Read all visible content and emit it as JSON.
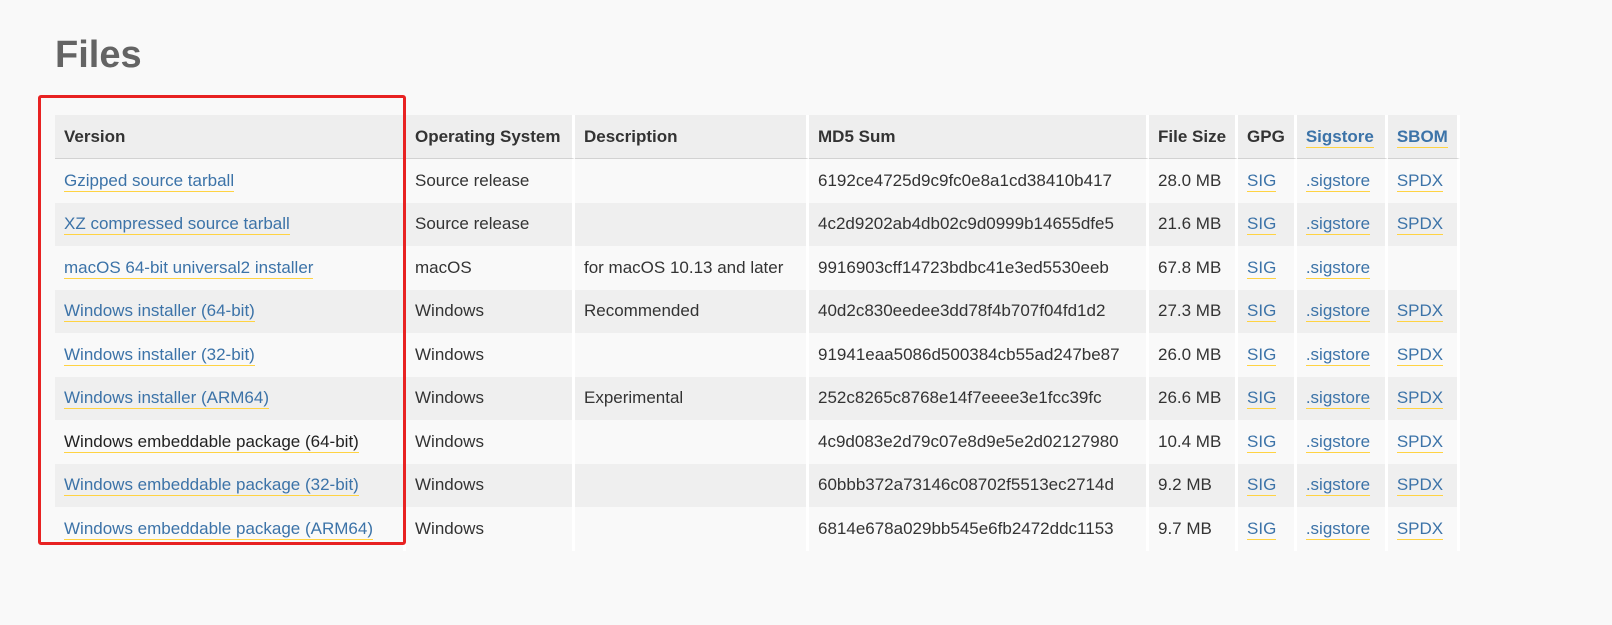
{
  "page": {
    "title": "Files",
    "highlight_color": "#e82222",
    "link_color": "#3c73a8",
    "underline_color": "#ffd343"
  },
  "table": {
    "headers": {
      "version": "Version",
      "os": "Operating System",
      "description": "Description",
      "md5": "MD5 Sum",
      "size": "File Size",
      "gpg": "GPG",
      "sigstore": "Sigstore",
      "sbom": "SBOM"
    },
    "rows": [
      {
        "version": "Gzipped source tarball",
        "os": "Source release",
        "description": "",
        "md5": "6192ce4725d9c9fc0e8a1cd38410b417",
        "size": "28.0 MB",
        "gpg": "SIG",
        "sigstore": ".sigstore",
        "sbom": "SPDX"
      },
      {
        "version": "XZ compressed source tarball",
        "os": "Source release",
        "description": "",
        "md5": "4c2d9202ab4db02c9d0999b14655dfe5",
        "size": "21.6 MB",
        "gpg": "SIG",
        "sigstore": ".sigstore",
        "sbom": "SPDX"
      },
      {
        "version": "macOS 64-bit universal2 installer",
        "os": "macOS",
        "description": "for macOS 10.13 and later",
        "md5": "9916903cff14723bdbc41e3ed5530eeb",
        "size": "67.8 MB",
        "gpg": "SIG",
        "sigstore": ".sigstore",
        "sbom": ""
      },
      {
        "version": "Windows installer (64-bit)",
        "os": "Windows",
        "description": "Recommended",
        "md5": "40d2c830eedee3dd78f4b707f04fd1d2",
        "size": "27.3 MB",
        "gpg": "SIG",
        "sigstore": ".sigstore",
        "sbom": "SPDX"
      },
      {
        "version": "Windows installer (32-bit)",
        "os": "Windows",
        "description": "",
        "md5": "91941eaa5086d500384cb55ad247be87",
        "size": "26.0 MB",
        "gpg": "SIG",
        "sigstore": ".sigstore",
        "sbom": "SPDX"
      },
      {
        "version": "Windows installer (ARM64)",
        "os": "Windows",
        "description": "Experimental",
        "md5": "252c8265c8768e14f7eeee3e1fcc39fc",
        "size": "26.6 MB",
        "gpg": "SIG",
        "sigstore": ".sigstore",
        "sbom": "SPDX"
      },
      {
        "version": "Windows embeddable package (64-bit)",
        "os": "Windows",
        "description": "",
        "md5": "4c9d083e2d79c07e8d9e5e2d02127980",
        "size": "10.4 MB",
        "gpg": "SIG",
        "sigstore": ".sigstore",
        "sbom": "SPDX"
      },
      {
        "version": "Windows embeddable package (32-bit)",
        "os": "Windows",
        "description": "",
        "md5": "60bbb372a73146c08702f5513ec2714d",
        "size": "9.2 MB",
        "gpg": "SIG",
        "sigstore": ".sigstore",
        "sbom": "SPDX"
      },
      {
        "version": "Windows embeddable package (ARM64)",
        "os": "Windows",
        "description": "",
        "md5": "6814e678a029bb545e6fb2472ddc1153",
        "size": "9.7 MB",
        "gpg": "SIG",
        "sigstore": ".sigstore",
        "sbom": "SPDX"
      }
    ]
  }
}
